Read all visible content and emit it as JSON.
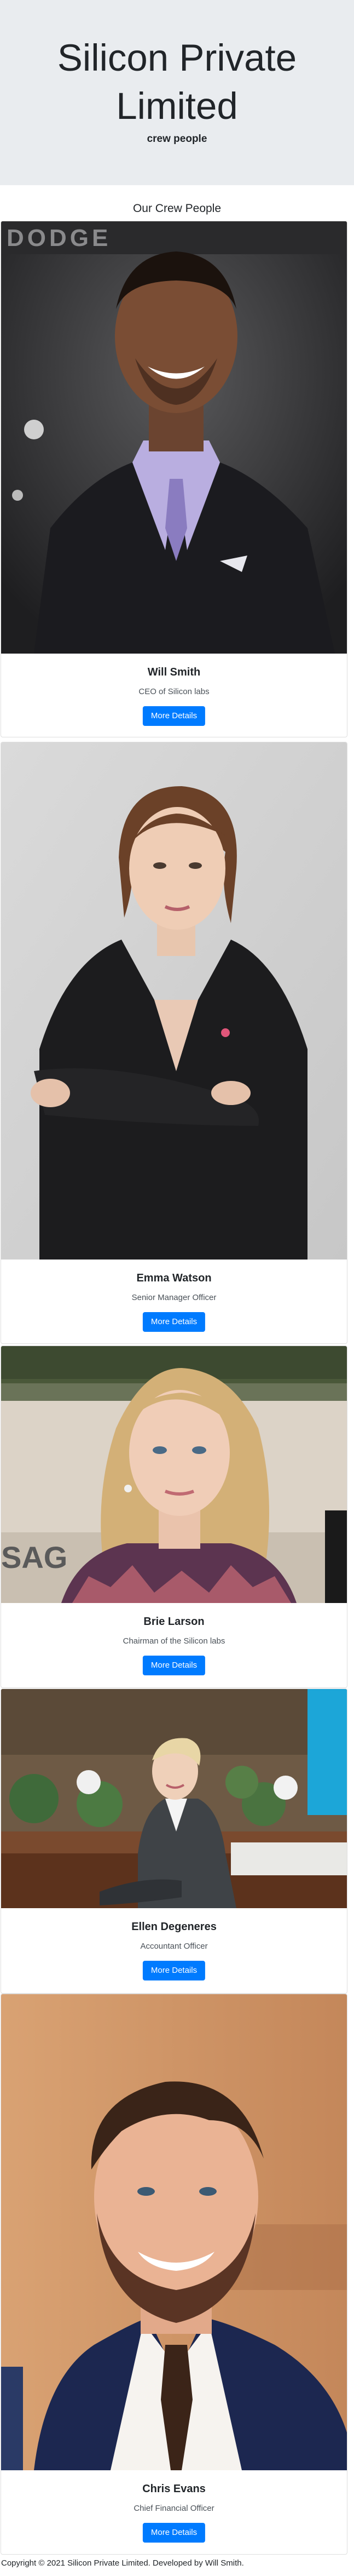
{
  "header": {
    "title": "Silicon Private Limited",
    "tagline": "crew people"
  },
  "section": {
    "title": "Our Crew People"
  },
  "crew": [
    {
      "name": "Will Smith",
      "role": "CEO of Silicon labs",
      "button": "More Details",
      "photo": "portrait-photo"
    },
    {
      "name": "Emma Watson",
      "role": "Senior Manager Officer",
      "button": "More Details",
      "photo": "portrait-photo"
    },
    {
      "name": "Brie Larson",
      "role": "Chairman of the Silicon labs",
      "button": "More Details",
      "photo": "portrait-photo"
    },
    {
      "name": "Ellen Degeneres",
      "role": "Accountant Officer",
      "button": "More Details",
      "photo": "portrait-photo"
    },
    {
      "name": "Chris Evans",
      "role": "Chief Financial Officer",
      "button": "More Details",
      "photo": "portrait-photo"
    }
  ],
  "footer": {
    "text": "Copyright © 2021 Silicon Private Limited. Developed by Will Smith."
  },
  "colors": {
    "hero_bg": "#e9ecef",
    "button": "#007bff"
  }
}
